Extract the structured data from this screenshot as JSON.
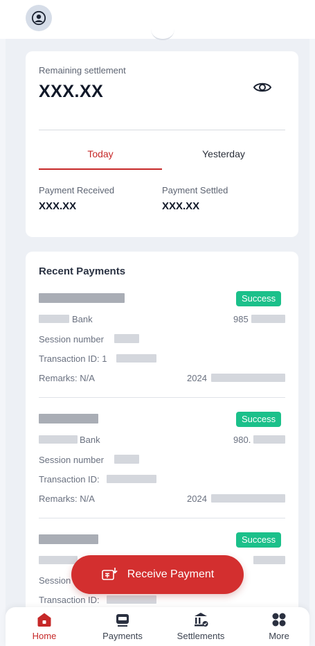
{
  "header": {
    "avatar_icon": "user-circle-icon"
  },
  "balance": {
    "remaining_label": "Remaining settlement",
    "remaining_value": "XXX.XX",
    "visibility_icon": "eye-icon",
    "tabs": [
      {
        "label": "Today",
        "active": true
      },
      {
        "label": "Yesterday",
        "active": false
      }
    ],
    "received_label": "Payment Received",
    "received_value": "XXX.XX",
    "settled_label": "Payment Settled",
    "settled_value": "XXX.XX"
  },
  "recent": {
    "title": "Recent Payments",
    "items": [
      {
        "status": "Success",
        "bank_suffix": "Bank",
        "account_prefix": "985",
        "session_label": "Session number",
        "txn_label": "Transaction ID: 1",
        "remarks": "Remarks: N/A",
        "date_prefix": "2024"
      },
      {
        "status": "Success",
        "bank_suffix": "Bank",
        "account_prefix": "980.",
        "session_label": "Session number",
        "txn_label": "Transaction ID:",
        "remarks": "Remarks: N/A",
        "date_prefix": "2024"
      },
      {
        "status": "Success",
        "session_label": "Session",
        "txn_label": "Transaction ID:"
      }
    ]
  },
  "fab": {
    "label": "Receive Payment",
    "icon": "receive-payment-icon"
  },
  "nav": {
    "items": [
      {
        "label": "Home",
        "icon": "home-icon",
        "active": true
      },
      {
        "label": "Payments",
        "icon": "payments-icon",
        "active": false
      },
      {
        "label": "Settlements",
        "icon": "bank-icon",
        "active": false
      },
      {
        "label": "More",
        "icon": "grid-icon",
        "active": false
      }
    ]
  },
  "colors": {
    "accent": "#c62828",
    "success": "#1bc08a",
    "background": "#edf0f5"
  }
}
